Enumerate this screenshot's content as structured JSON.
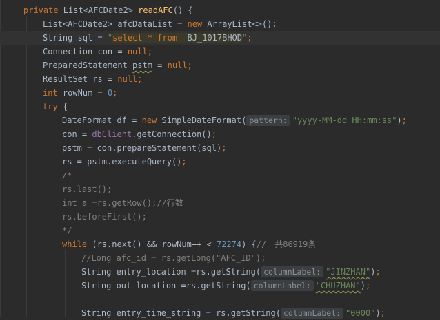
{
  "lines": [
    {
      "text_parts": [
        "private",
        " List<AFCDate2> ",
        "readAFC",
        "() {"
      ]
    },
    {
      "text_parts": [
        "List<AFCDate2> afcDataList = ",
        "new",
        " ArrayList<>()",
        ";"
      ]
    },
    {
      "text_parts": [
        "String sql = ",
        "\"",
        "select * from",
        "  BJ_1017BHOD",
        "\"",
        ";"
      ]
    },
    {
      "text_parts": [
        "Connection con = ",
        "null",
        ";"
      ]
    },
    {
      "text_parts": [
        "PreparedStatement ",
        "pstm",
        " = ",
        "null",
        ";"
      ]
    },
    {
      "text_parts": [
        "ResultSet rs = ",
        "null",
        ";"
      ]
    },
    {
      "text_parts": [
        "int",
        " rowNum = ",
        "0",
        ";"
      ]
    },
    {
      "text_parts": [
        "try",
        " {"
      ]
    },
    {
      "text_parts": [
        "DateFormat df = ",
        "new",
        " SimpleDateFormat(",
        "pattern:",
        "\"yyyy-MM-dd HH:mm:ss\"",
        ")",
        ";"
      ]
    },
    {
      "text_parts": [
        "con = ",
        "dbClient",
        ".getConnection()",
        ";"
      ]
    },
    {
      "text_parts": [
        "pstm = con.prepareStatement(sql)",
        ";"
      ]
    },
    {
      "text_parts": [
        "rs = pstm.executeQuery()",
        ";"
      ]
    },
    {
      "text_parts": [
        "/*"
      ]
    },
    {
      "text_parts": [
        "rs.last();"
      ]
    },
    {
      "text_parts": [
        "int a =rs.getRow();//行数"
      ]
    },
    {
      "text_parts": [
        "rs.beforeFirst();"
      ]
    },
    {
      "text_parts": [
        "*/"
      ]
    },
    {
      "text_parts": [
        "while",
        " (rs.next() && rowNum++ < ",
        "72274",
        ") {",
        "//一共86919条"
      ]
    },
    {
      "text_parts": [
        "//Long afc_id = rs.getLong(\"AFC_ID\");"
      ]
    },
    {
      "text_parts": [
        "String entry_location =rs.getString(",
        "columnLabel:",
        "\"JINZHAN\"",
        ")",
        ";"
      ]
    },
    {
      "text_parts": [
        "String out_location =rs.getString(",
        "columnLabel:",
        "\"CHUZHAN\"",
        ")",
        ";"
      ]
    },
    {
      "text_parts": [
        ""
      ]
    },
    {
      "text_parts": [
        "String entry_time_string = rs.getString(",
        "columnLabel:",
        "\"0000\"",
        ")",
        ";"
      ]
    }
  ],
  "colors": {
    "background": "#2b2b2b",
    "keyword": "#cc7832",
    "function": "#ffc66d",
    "string": "#6a8759",
    "number": "#6897bb",
    "comment": "#808080",
    "field": "#9876aa"
  }
}
